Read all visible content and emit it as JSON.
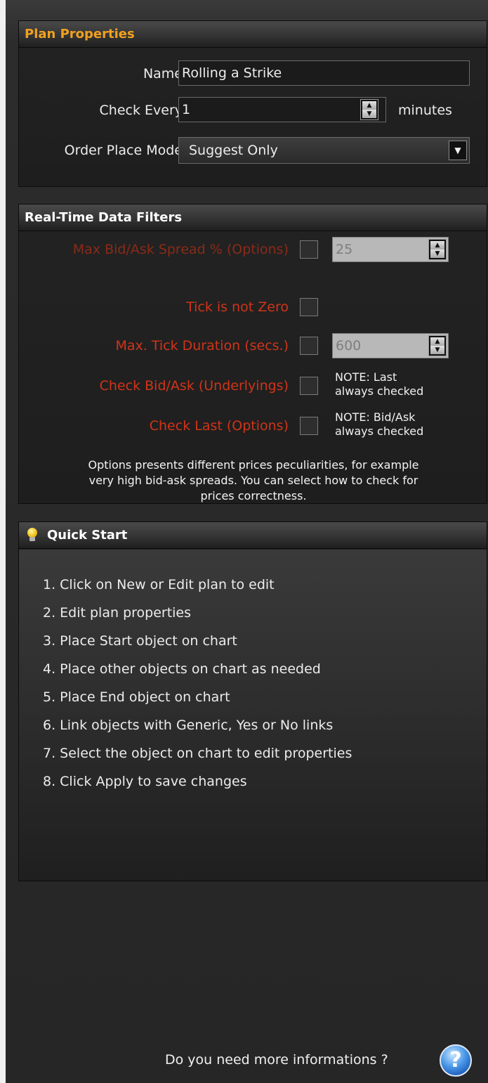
{
  "plan_properties": {
    "title": "Plan Properties",
    "name_label": "Name",
    "name_value": "Rolling a Strike",
    "check_every_label": "Check Every",
    "check_every_value": "1",
    "check_every_unit": "minutes",
    "order_mode_label": "Order Place Mode",
    "order_mode_value": "Suggest Only"
  },
  "filters": {
    "title": "Real-Time Data Filters",
    "max_spread_label": "Max Bid/Ask Spread % (Options)",
    "max_spread_value": "25",
    "tick_not_zero_label": "Tick is not Zero",
    "max_tick_duration_label": "Max. Tick Duration (secs.)",
    "max_tick_duration_value": "600",
    "check_bid_ask_label": "Check Bid/Ask (Underlyings)",
    "check_bid_ask_note_1": "NOTE: Last",
    "check_bid_ask_note_2": "always checked",
    "check_last_label": "Check Last (Options)",
    "check_last_note_1": "NOTE: Bid/Ask",
    "check_last_note_2": "always checked",
    "description_1": "Options presents different prices peculiarities, for example",
    "description_2": "very high bid-ask spreads. You can select how to check for",
    "description_3": "prices correctness."
  },
  "quick_start": {
    "title": "Quick Start",
    "icon": "lightbulb-icon",
    "steps": [
      "1. Click on New or Edit plan to edit",
      "2. Edit plan properties",
      "3. Place Start object on chart",
      "4. Place other objects on chart as needed",
      "5. Place End object on chart",
      "6. Link objects with Generic, Yes or No links",
      "7. Select the object on chart to edit properties",
      "8. Click Apply to save changes"
    ]
  },
  "footer": {
    "help_text": "Do you need more informations ?",
    "help_icon": "help-icon",
    "help_glyph": "?"
  }
}
